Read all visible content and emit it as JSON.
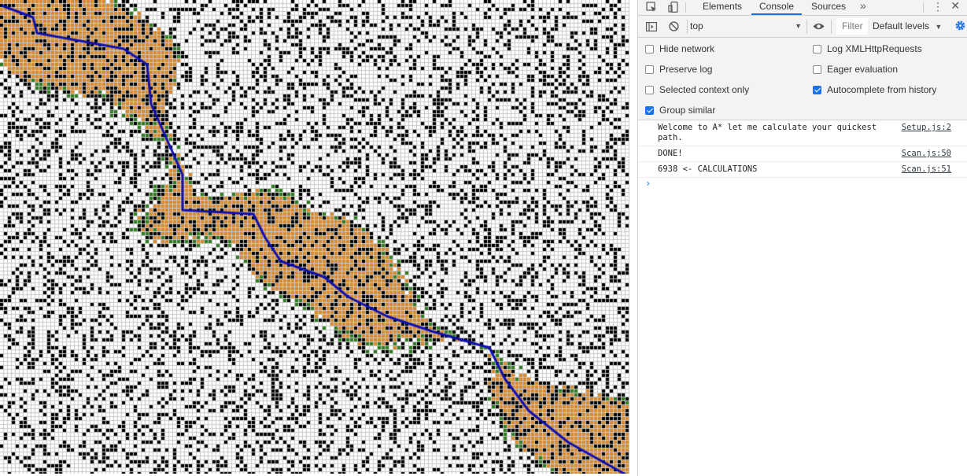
{
  "devtools": {
    "tabs": [
      {
        "label": "Elements"
      },
      {
        "label": "Console"
      },
      {
        "label": "Sources"
      }
    ],
    "more_tabs_glyph": "»",
    "menu_glyph": "⋮",
    "close_glyph": "✕",
    "icons": [
      "inspect-icon",
      "device-toolbar-icon",
      "sidebar-toggle-icon",
      "clear-console-icon",
      "eye-icon",
      "gear-icon",
      "chevron-down-icon"
    ],
    "toolbar": {
      "context": "top",
      "context_arrow": "▼",
      "filter_placeholder": "Filter",
      "levels_label": "Default levels",
      "levels_arrow": "▼"
    },
    "settings": {
      "left": [
        {
          "label": "Hide network",
          "checked": false
        },
        {
          "label": "Preserve log",
          "checked": false
        },
        {
          "label": "Selected context only",
          "checked": false
        },
        {
          "label": "Group similar",
          "checked": true
        }
      ],
      "right": [
        {
          "label": "Log XMLHttpRequests",
          "checked": false
        },
        {
          "label": "Eager evaluation",
          "checked": false
        },
        {
          "label": "Autocomplete from history",
          "checked": true
        }
      ]
    },
    "console": {
      "messages": [
        {
          "text": "Welcome to A* let me calculate your quickest path.",
          "source": "Setup.js:2"
        },
        {
          "text": "DONE!",
          "source": "Scan.js:50"
        },
        {
          "text": "6938 <- CALCULATIONS",
          "source": "Scan.js:51"
        }
      ],
      "prompt_glyph": "›"
    },
    "accent_color": "#1a73e8"
  },
  "grid": {
    "colors": {
      "wall": "#000000",
      "open": "#ffffff",
      "cell_border": "#c8c8c8",
      "explored": "#d98a2c",
      "frontier": "#2e7d1f",
      "path": "#1010b0"
    }
  }
}
